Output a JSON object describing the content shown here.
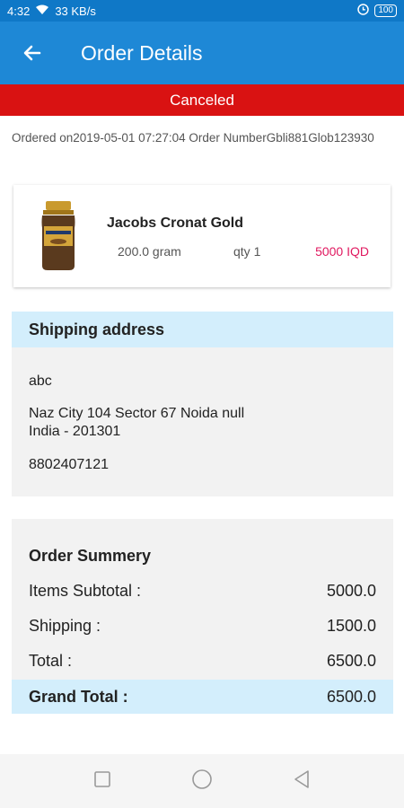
{
  "status_bar": {
    "time": "4:32",
    "network_speed": "33 KB/s",
    "battery": "100"
  },
  "app_bar": {
    "title": "Order Details",
    "back_icon": "arrow-left-icon"
  },
  "order": {
    "status": "Canceled",
    "ordered_on_text": "Ordered on2019-05-01 07:27:04",
    "order_number_text": "Order NumberGbli881Glob123930"
  },
  "product": {
    "name": "Jacobs Cronat Gold",
    "weight": "200.0 gram",
    "qty": "qty 1",
    "price": "5000 IQD"
  },
  "shipping": {
    "heading": "Shipping address",
    "name": "abc",
    "address_line1": "Naz City 104 Sector 67 Noida null",
    "address_line2": "India - 201301",
    "phone": "8802407121"
  },
  "summary": {
    "heading": "Order Summery",
    "rows": [
      {
        "label": "Items Subtotal :",
        "value": "5000.0"
      },
      {
        "label": "Shipping :",
        "value": "1500.0"
      },
      {
        "label": "Total :",
        "value": "6500.0"
      }
    ],
    "grand_total": {
      "label": "Grand Total :",
      "value": "6500.0"
    }
  },
  "colors": {
    "app_bar": "#1e88d6",
    "status_bar": "#0f78c7",
    "canceled_strip": "#d91212",
    "price": "#e0185f",
    "section_header": "#d3eefc",
    "section_bg": "#f2f2f2"
  }
}
